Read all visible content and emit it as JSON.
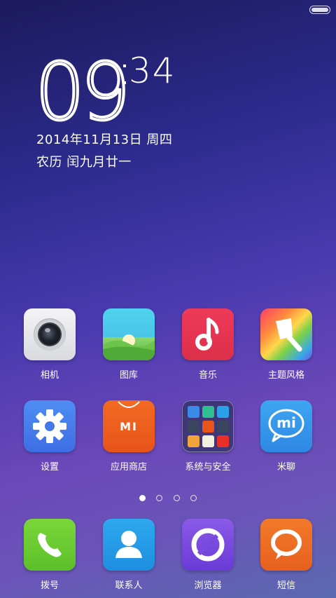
{
  "clock": {
    "hour": "09",
    "minute": "34"
  },
  "date": "2014年11月13日 周四",
  "lunar": "农历 闰九月廿一",
  "apps_row1": [
    {
      "label": "相机",
      "icon": "camera-icon"
    },
    {
      "label": "图库",
      "icon": "gallery-icon"
    },
    {
      "label": "音乐",
      "icon": "music-icon"
    },
    {
      "label": "主题风格",
      "icon": "theme-icon"
    }
  ],
  "apps_row2": [
    {
      "label": "设置",
      "icon": "settings-gear-icon"
    },
    {
      "label": "应用商店",
      "icon": "app-store-icon"
    },
    {
      "label": "系统与安全",
      "icon": "folder-icon"
    },
    {
      "label": "米聊",
      "icon": "mitalk-icon"
    }
  ],
  "dock": [
    {
      "label": "拨号",
      "icon": "phone-icon"
    },
    {
      "label": "联系人",
      "icon": "contacts-icon"
    },
    {
      "label": "浏览器",
      "icon": "browser-icon"
    },
    {
      "label": "短信",
      "icon": "sms-icon"
    }
  ],
  "store_text": "MI",
  "mitalk_text": "mi",
  "page_indicator": {
    "count": 4,
    "active": 1
  }
}
